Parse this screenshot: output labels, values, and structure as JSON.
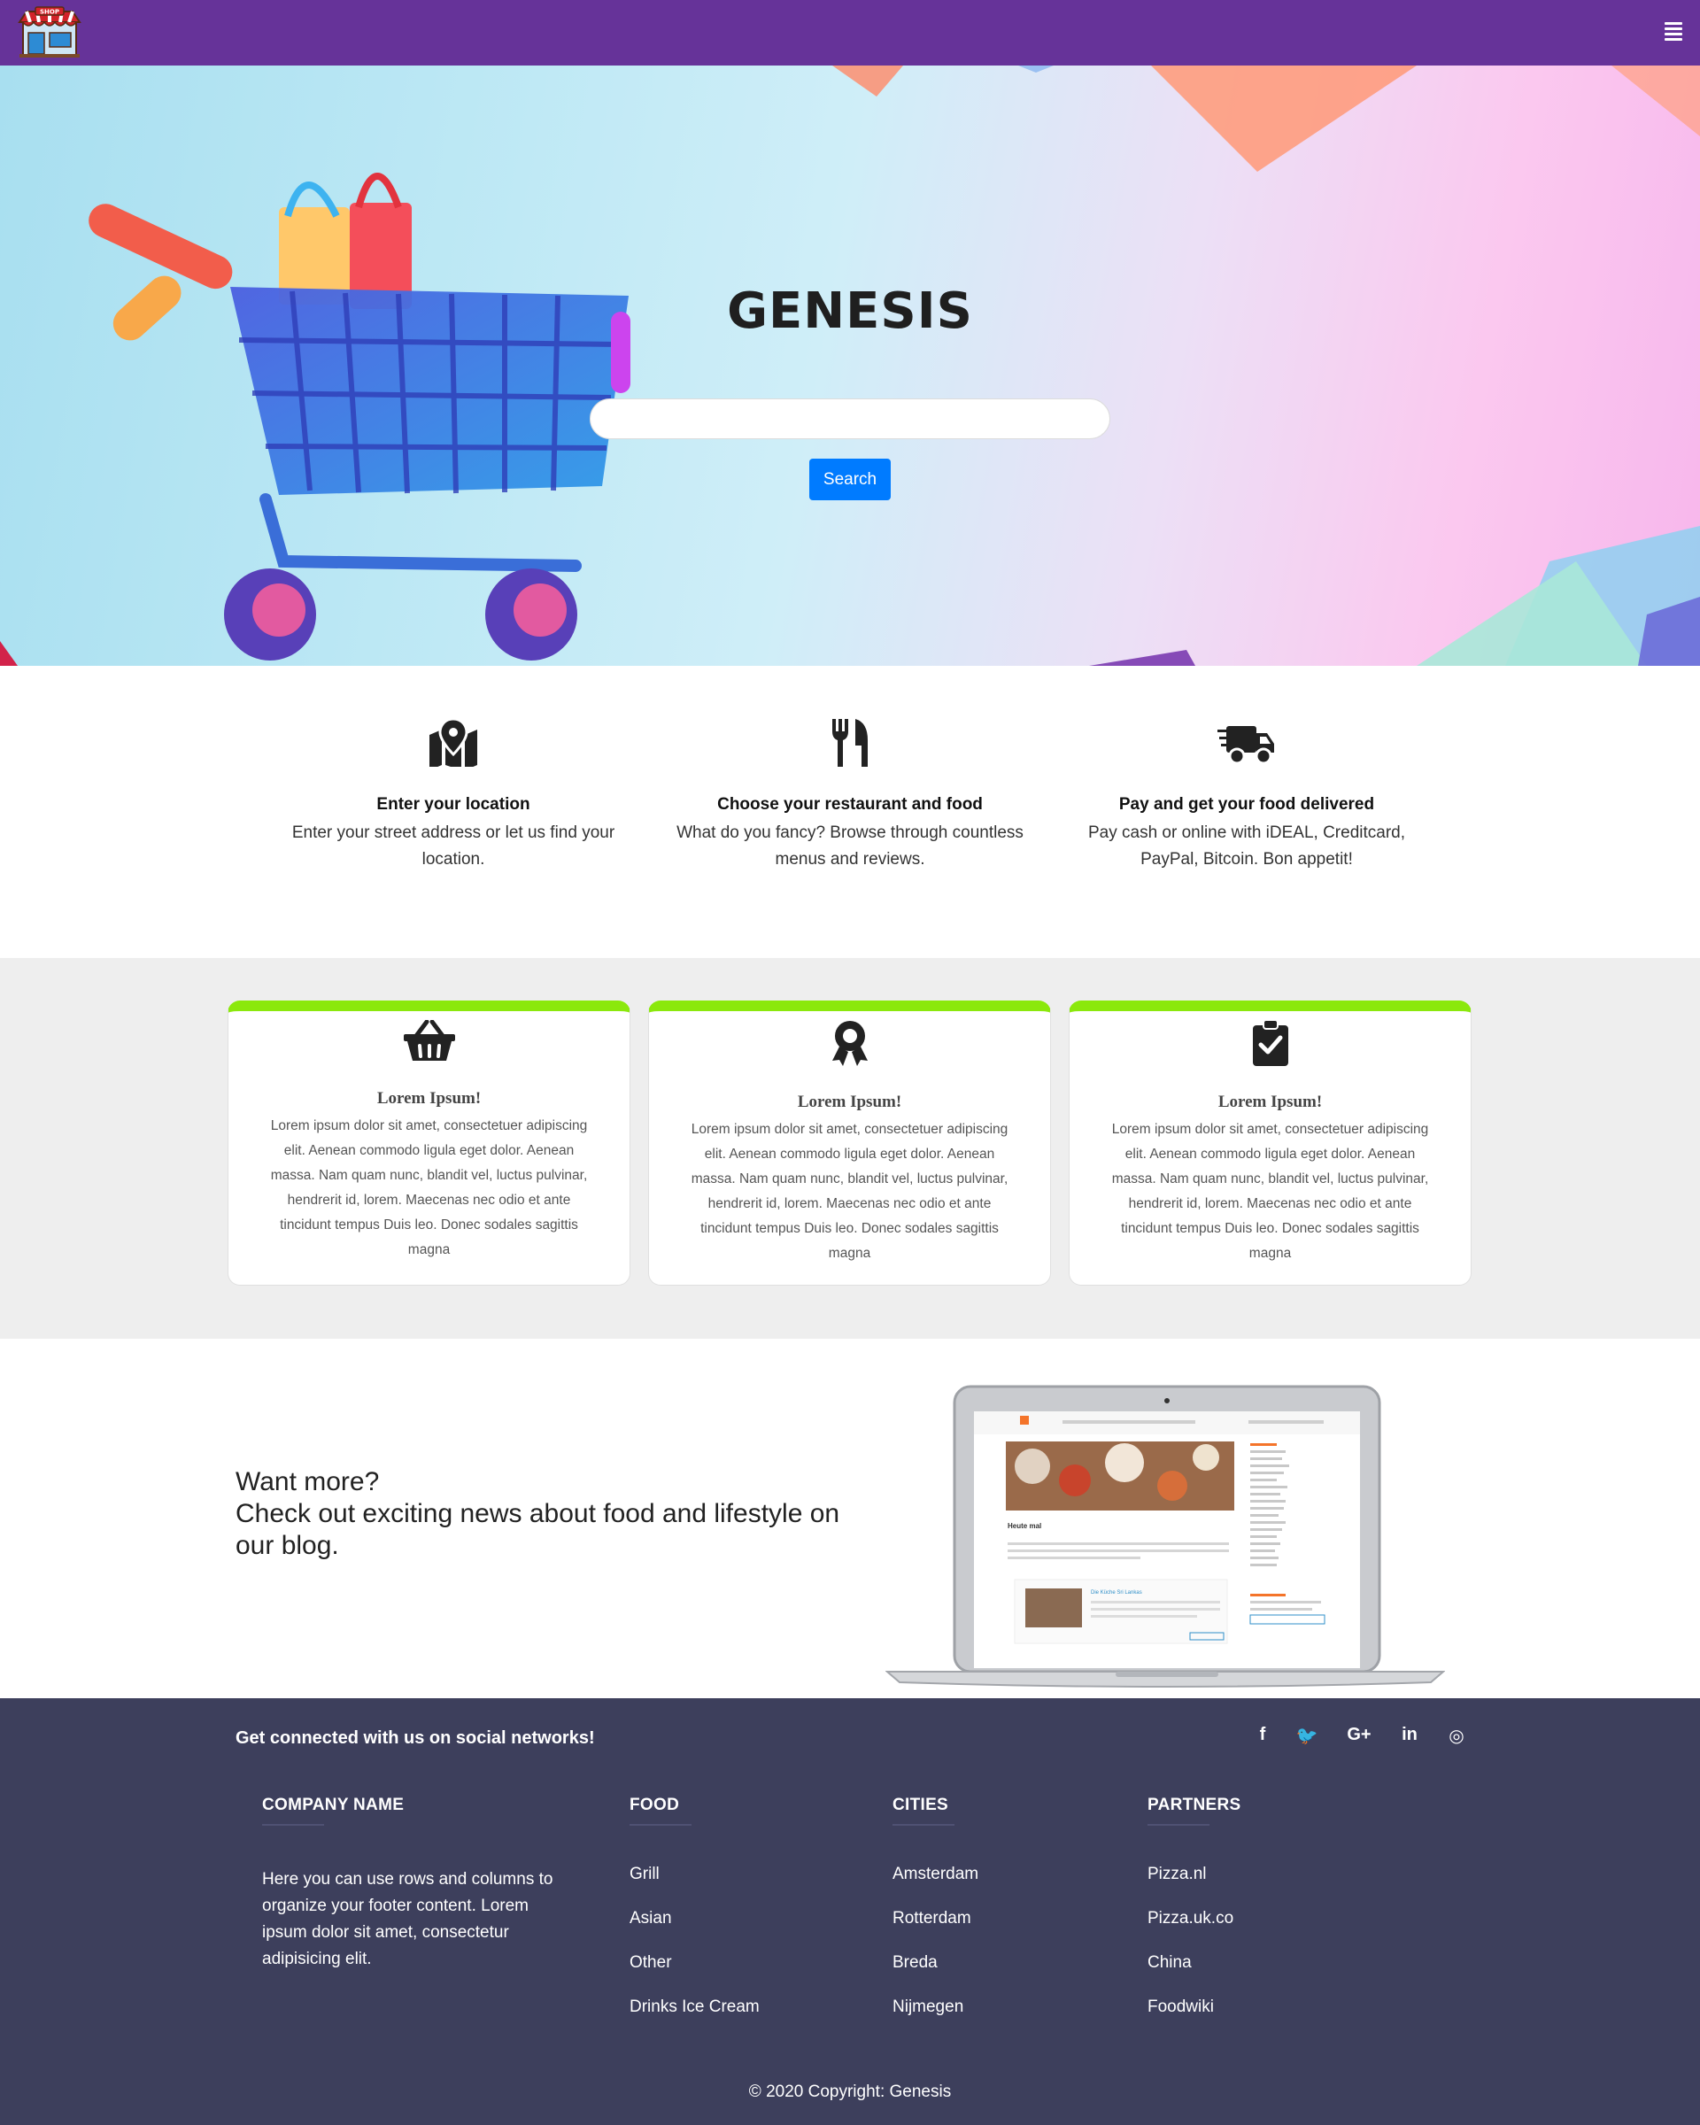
{
  "navbar": {
    "logo_text": "SHOP",
    "menu_icon": "hamburger-icon"
  },
  "hero": {
    "title": "GENESIS",
    "search_placeholder": "",
    "search_button": "Search"
  },
  "steps": [
    {
      "icon": "map-marker-icon",
      "title": "Enter your location",
      "desc": "Enter your street address or let us find your location."
    },
    {
      "icon": "utensils-icon",
      "title": "Choose your restaurant and food",
      "desc": "What do you fancy? Browse through countless menus and reviews."
    },
    {
      "icon": "delivery-truck-icon",
      "title": "Pay and get your food delivered",
      "desc": "Pay cash or online with iDEAL, Creditcard, PayPal, Bitcoin. Bon appetit!"
    }
  ],
  "features": [
    {
      "icon": "basket-icon",
      "title": "Lorem Ipsum!",
      "text": "Lorem ipsum dolor sit amet, consectetuer adipiscing elit. Aenean commodo ligula eget dolor. Aenean massa. Nam quam nunc, blandit vel, luctus pulvinar, hendrerit id, lorem. Maecenas nec odio et ante tincidunt tempus Duis leo. Donec sodales sagittis magna"
    },
    {
      "icon": "award-icon",
      "title": "Lorem Ipsum!",
      "text": "Lorem ipsum dolor sit amet, consectetuer adipiscing elit. Aenean commodo ligula eget dolor. Aenean massa. Nam quam nunc, blandit vel, luctus pulvinar, hendrerit id, lorem. Maecenas nec odio et ante tincidunt tempus Duis leo. Donec sodales sagittis magna"
    },
    {
      "icon": "clipboard-check-icon",
      "title": "Lorem Ipsum!",
      "text": "Lorem ipsum dolor sit amet, consectetuer adipiscing elit. Aenean commodo ligula eget dolor. Aenean massa. Nam quam nunc, blandit vel, luctus pulvinar, hendrerit id, lorem. Maecenas nec odio et ante tincidunt tempus Duis leo. Donec sodales sagittis magna"
    }
  ],
  "blog": {
    "line1": "Want more?",
    "line2": "Check out exciting news about food and lifestyle on our blog.",
    "laptop_screen_heading": "Heute mal",
    "laptop_screen_subheading": "Die Küche Sri Lankas"
  },
  "footer": {
    "social_tagline": "Get connected with us on social networks!",
    "social_icons": [
      {
        "name": "facebook-icon",
        "glyph": "f"
      },
      {
        "name": "twitter-icon",
        "glyph": "🐦"
      },
      {
        "name": "google-plus-icon",
        "glyph": "G+"
      },
      {
        "name": "linkedin-icon",
        "glyph": "in"
      },
      {
        "name": "instagram-icon",
        "glyph": "◎"
      }
    ],
    "company": {
      "heading": "COMPANY NAME",
      "body": "Here you can use rows and columns to organize your footer content. Lorem ipsum dolor sit amet, consectetur adipisicing elit."
    },
    "food": {
      "heading": "FOOD",
      "links": [
        "Grill",
        "Asian",
        "Other",
        "Drinks Ice Cream"
      ]
    },
    "cities": {
      "heading": "CITIES",
      "links": [
        "Amsterdam",
        "Rotterdam",
        "Breda",
        "Nijmegen"
      ]
    },
    "partners": {
      "heading": "PARTNERS",
      "links": [
        "Pizza.nl",
        "Pizza.uk.co",
        "China",
        "Foodwiki"
      ]
    },
    "copyright": "© 2020 Copyright: Genesis"
  },
  "colors": {
    "navbar": "#663399",
    "accent_blue": "#007bff",
    "card_top": "#8be80c",
    "footer_bg": "#3d3f5c"
  }
}
